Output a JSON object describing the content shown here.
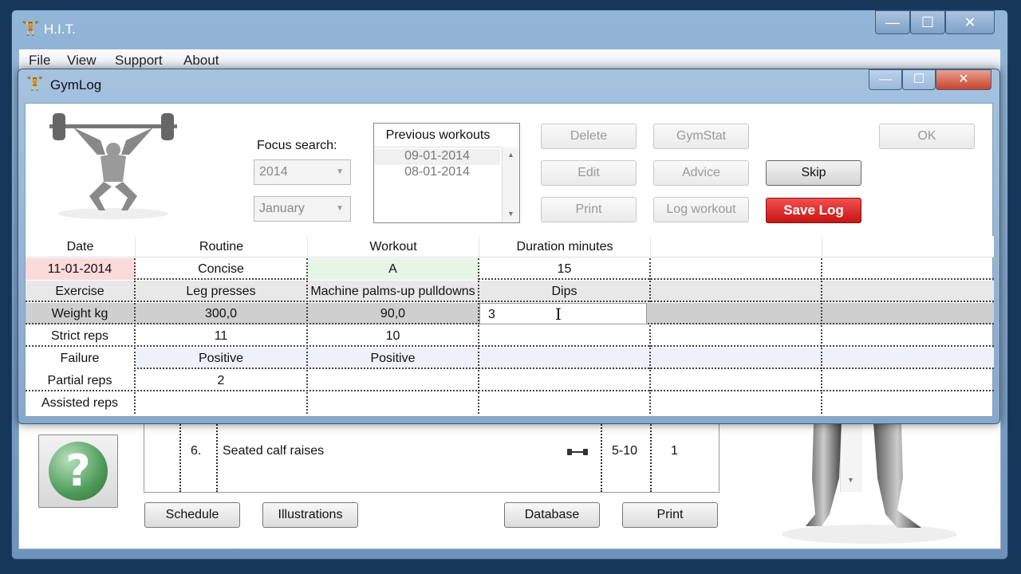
{
  "main_window": {
    "title": "H.I.T.",
    "controls": {
      "minimize": "—",
      "maximize": "☐",
      "close": "✕"
    },
    "menu": [
      "File",
      "View",
      "Support",
      "About"
    ]
  },
  "exercise_list": {
    "row": {
      "number": "6.",
      "exercise": "Seated calf raises",
      "reps": "5-10",
      "sets": "1"
    }
  },
  "help_button": "?",
  "bottom_buttons": {
    "schedule": "Schedule",
    "illustrations": "Illustrations",
    "database": "Database",
    "print": "Print"
  },
  "gymlog": {
    "title": "GymLog",
    "focus_search_label": "Focus search:",
    "year_select": "2014",
    "month_select": "January",
    "previous_workouts": {
      "header": "Previous workouts",
      "items": [
        "09-01-2014",
        "08-01-2014"
      ]
    },
    "buttons": {
      "delete": "Delete",
      "edit": "Edit",
      "print": "Print",
      "gymstat": "GymStat",
      "advice": "Advice",
      "log_workout": "Log workout",
      "skip": "Skip",
      "save_log": "Save Log",
      "ok": "OK"
    },
    "grid": {
      "header": [
        "Date",
        "Routine",
        "Workout",
        "Duration minutes",
        "",
        ""
      ],
      "info": [
        "11-01-2014",
        "Concise",
        "A",
        "15",
        "",
        ""
      ],
      "rows": [
        [
          "Exercise",
          "Leg presses",
          "Machine palms-up pulldowns",
          "Dips",
          "",
          ""
        ],
        [
          "Weight kg",
          "300,0",
          "90,0",
          "3",
          "",
          ""
        ],
        [
          "Strict reps",
          "11",
          "10",
          "",
          "",
          ""
        ],
        [
          "Failure",
          "Positive",
          "Positive",
          "",
          "",
          ""
        ],
        [
          "Partial reps",
          "2",
          "",
          "",
          "",
          ""
        ],
        [
          "Assisted reps",
          "",
          "",
          "",
          "",
          ""
        ]
      ]
    }
  },
  "colors": {
    "save_log": "#d81e1e",
    "date_cell": "#fbdada",
    "workout_cell": "#e6f5e6",
    "failure_row": "#eef0fb",
    "weight_row": "#cfcfcf"
  }
}
